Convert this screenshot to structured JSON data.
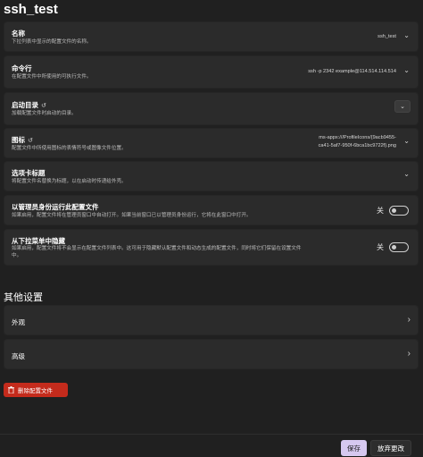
{
  "page": {
    "title": "ssh_test"
  },
  "settings": {
    "name": {
      "title": "名称",
      "desc": "下拉列表中显示的配置文件的名称。",
      "value": "ssh_test"
    },
    "commandline": {
      "title": "命令行",
      "desc": "在配置文件中所使用的可执行文件。",
      "value": "ssh -p 2342 example@114.514.114.514"
    },
    "start_dir": {
      "title": "启动目录",
      "desc": "加载配置文件时启动的目录。",
      "dropdown": "⌄"
    },
    "icon": {
      "title": "图标",
      "desc": "配置文件中所使用图标的表情符号或图像文件位置。",
      "value_line1": "ms-appx:///ProfileIcons/{9acb9455-",
      "value_line2": "ca41-5af7-950f-6bca1bc9722f}.png"
    },
    "tab_title": {
      "title": "选项卡标题",
      "desc": "将配置文件名替换为标题，以在启动时传递给外壳。"
    },
    "run_as_admin": {
      "title": "以管理员身份运行此配置文件",
      "desc": "如果启用，配置文件将在管理员窗口中自动打开。如果当前窗口已以管理员身份运行，它将在此窗口中打开。",
      "state": "关"
    },
    "hide_from_dropdown": {
      "title": "从下拉菜单中隐藏",
      "desc_line1": "如果启用，配置文件将不会显示在配置文件列表中。这可用于隐藏默认配置文件和动态生成的配置文件，同时将它们保留在设置文件",
      "desc_line2": "中。",
      "state": "关"
    }
  },
  "other": {
    "heading": "其他设置",
    "appearance": "外观",
    "advanced": "高级"
  },
  "actions": {
    "delete": "删除配置文件",
    "save": "保存",
    "discard": "放弃更改"
  },
  "icons": {
    "reset": "reset-icon",
    "chevron_down": "chevron-down-icon",
    "chevron_right": "chevron-right-icon",
    "trash": "trash-icon"
  },
  "colors": {
    "accent": "#d6c8f0",
    "danger": "#c42b1c",
    "card": "#2b2b2b",
    "background": "#202020"
  }
}
